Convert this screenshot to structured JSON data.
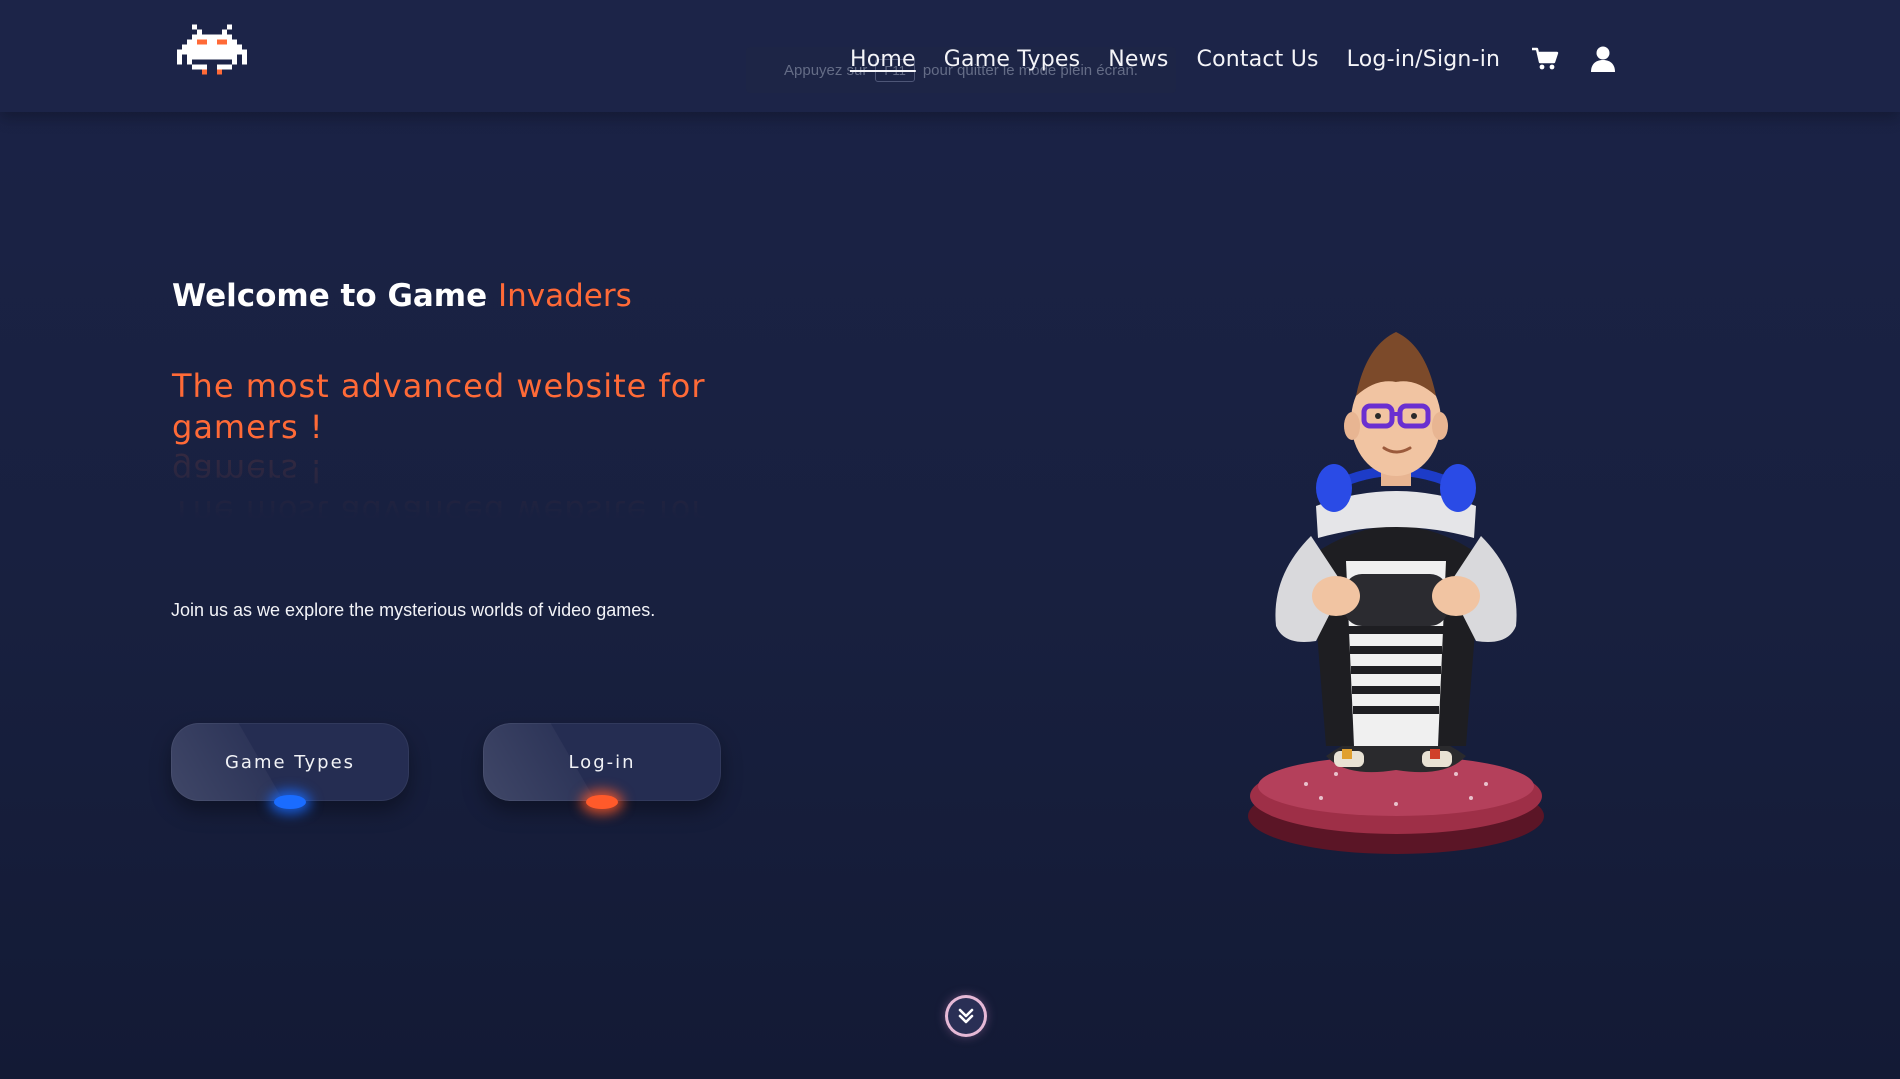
{
  "header": {
    "logo_icon": "space-invader-icon",
    "fullscreen_notice": {
      "before": "Appuyez sur",
      "key": "F11",
      "after": "pour quitter le mode plein écran."
    },
    "nav": {
      "home": "Home",
      "game_types": "Game Types",
      "news": "News",
      "contact": "Contact Us",
      "login_signin": "Log-in/Sign-in"
    },
    "icons": [
      "cart-icon",
      "user-icon"
    ]
  },
  "hero": {
    "welcome_prefix": "Welcome to Game",
    "welcome_accent": "Invaders",
    "tagline_line1": "The most advanced website for",
    "tagline_line2": "gamers !",
    "intro": "Join us as we explore the mysterious worlds of video games.",
    "buttons": {
      "game_types": "Game Types",
      "login": "Log-in"
    },
    "figure_icon": "gamer-character-illustration",
    "scroll_icon": "double-chevron-down-icon"
  },
  "colors": {
    "background": "#18203f",
    "header": "#1c2448",
    "accent_orange": "#ff6a37",
    "glow_blue": "#1a6cff",
    "glow_orange": "#ff5a2a",
    "button": "#252d52"
  }
}
